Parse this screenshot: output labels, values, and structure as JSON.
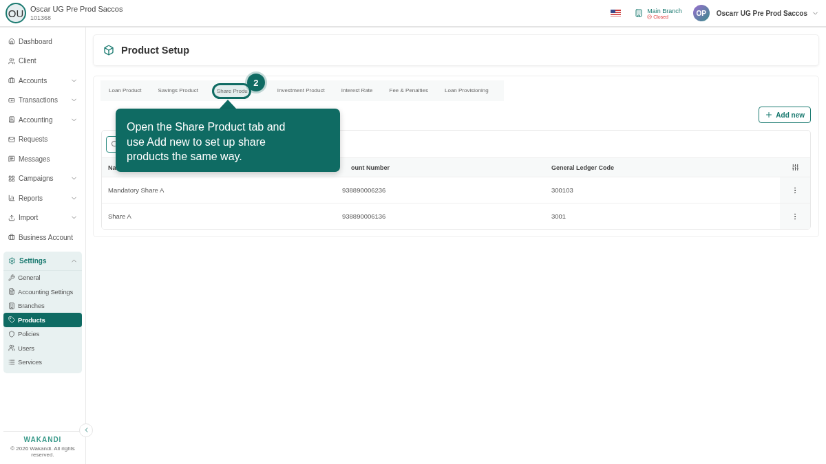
{
  "org": {
    "initials": "OU",
    "name": "Oscar UG Pre Prod Saccos",
    "code": "101368"
  },
  "topbar": {
    "branch": "Main Branch",
    "branch_status": "Closed",
    "user_initials": "OP",
    "user_name": "Oscarr UG Pre Prod Saccos"
  },
  "sidebar": {
    "items": [
      {
        "kind": "link",
        "label": "Dashboard"
      },
      {
        "kind": "link",
        "label": "Client"
      },
      {
        "kind": "group",
        "label": "Accounts",
        "expanded": false
      },
      {
        "kind": "group",
        "label": "Transactions",
        "expanded": false
      },
      {
        "kind": "group",
        "label": "Accounting",
        "expanded": false
      },
      {
        "kind": "link",
        "label": "Requests"
      },
      {
        "kind": "link",
        "label": "Messages"
      },
      {
        "kind": "group",
        "label": "Campaigns",
        "expanded": false
      },
      {
        "kind": "group",
        "label": "Reports",
        "expanded": false
      },
      {
        "kind": "group",
        "label": "Import",
        "expanded": false
      },
      {
        "kind": "link",
        "label": "Business Account"
      },
      {
        "kind": "group",
        "label": "Settings",
        "expanded": true,
        "children": [
          {
            "label": "General",
            "selected": false
          },
          {
            "label": "Accounting Settings",
            "selected": false
          },
          {
            "label": "Branches",
            "selected": false
          },
          {
            "label": "Products",
            "selected": true
          },
          {
            "label": "Policies",
            "selected": false
          },
          {
            "label": "Users",
            "selected": false
          },
          {
            "label": "Services",
            "selected": false
          }
        ]
      }
    ],
    "brand": "WAKANDI",
    "copyright": "© 2026 Wakandi. All rights reserved."
  },
  "page": {
    "title": "Product Setup"
  },
  "tabs": [
    {
      "label": "Loan Product",
      "selected": false
    },
    {
      "label": "Savings Product",
      "selected": false
    },
    {
      "label": "Share Produ",
      "selected": true
    },
    {
      "label": "Investment Product",
      "selected": false
    },
    {
      "label": "Interest Rate",
      "selected": false
    },
    {
      "label": "Fee & Penalties",
      "selected": false
    },
    {
      "label": "Loan Provisioning",
      "selected": false
    }
  ],
  "add_button": "Add new",
  "table": {
    "columns": [
      "Na",
      "ount Number",
      "General Ledger Code"
    ],
    "rows": [
      [
        "Mandatory Share A",
        "938890006236",
        "300103"
      ],
      [
        "Share A",
        "938890006136",
        "3001"
      ]
    ]
  },
  "guide": {
    "step": "2",
    "text": "Open the Share Product tab and use Add new to set up share products the same way."
  }
}
